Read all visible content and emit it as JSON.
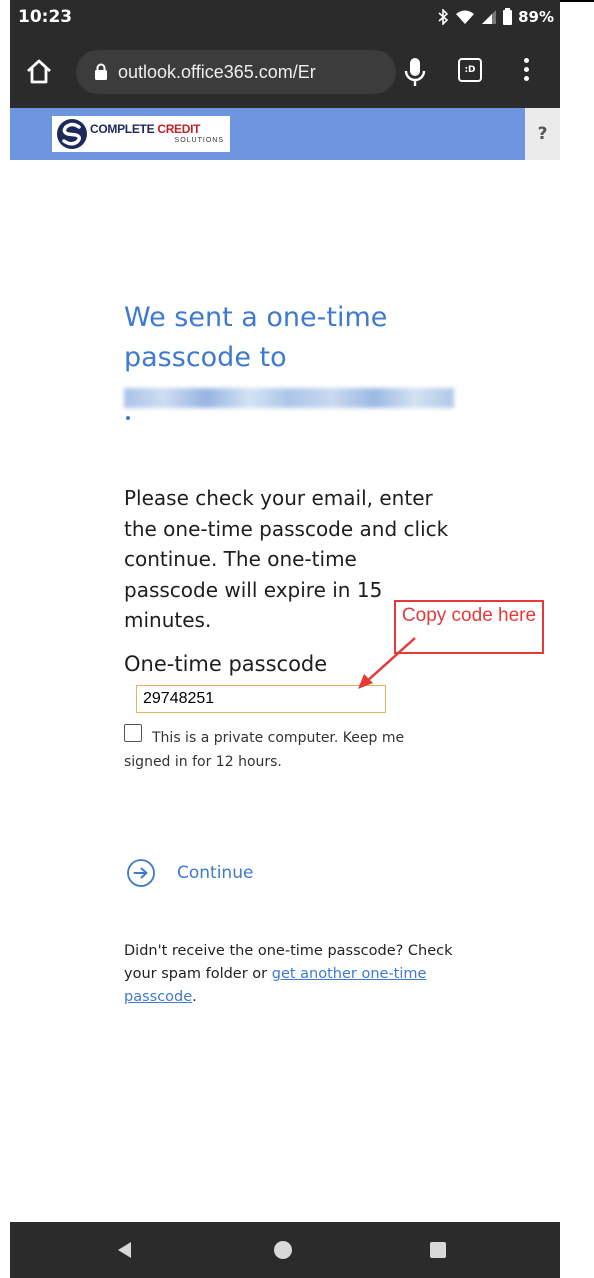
{
  "status_bar": {
    "time": "10:23",
    "battery": "89%"
  },
  "browser": {
    "url": "outlook.office365.com/Er",
    "icons": [
      "home-icon",
      "lock-icon",
      "microphone-icon",
      "tabs-icon",
      "overflow-menu-icon"
    ],
    "tab_count": ":D"
  },
  "brand": {
    "logo_text_primary_a": "COMPLETE",
    "logo_text_primary_b": "CREDIT",
    "logo_text_secondary": "SOLUTIONS",
    "help": "?",
    "bar_color": "#6e96e0"
  },
  "main": {
    "heading": "We sent a one-time passcode to",
    "email_redacted": "",
    "email_suffix": ".",
    "instructions": "Please check your email, enter the one-time passcode and click continue. The one-time passcode will expire in 15 minutes.",
    "field_label": "One-time passcode",
    "passcode_value": "29748251",
    "checkbox_label": "This is a private computer. Keep me signed in for 12 hours.",
    "checkbox_checked": false,
    "continue_label": "Continue",
    "help_text_a": "Didn't receive the one-time passcode? Check your spam folder or ",
    "help_link": "get another one-time passcode",
    "help_text_b": "."
  },
  "annotation": {
    "callout_text": "Copy code here",
    "color": "#e53a3a"
  },
  "nav": {
    "icons": [
      "back-icon",
      "home-circle-icon",
      "recents-icon"
    ]
  },
  "colors": {
    "accent": "#3f7ad0",
    "chrome": "#2b2b2b",
    "input_border": "#e3b35f"
  }
}
